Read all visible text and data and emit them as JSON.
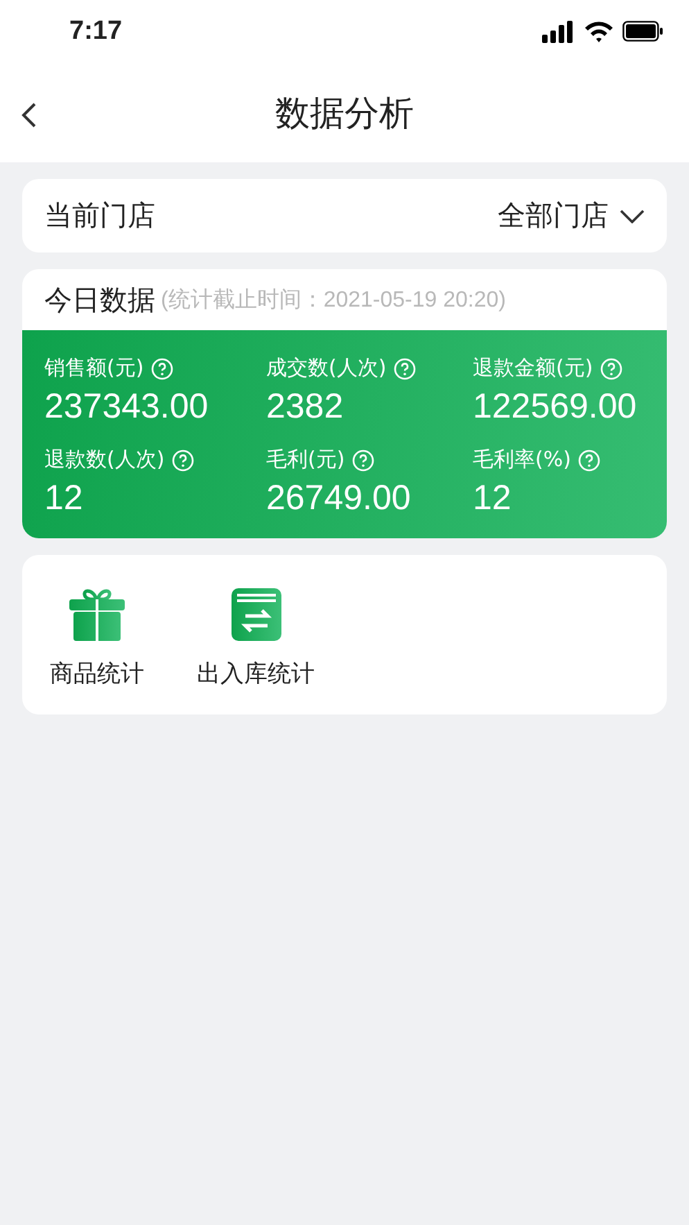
{
  "status_bar": {
    "time": "7:17"
  },
  "nav": {
    "title": "数据分析"
  },
  "store": {
    "label": "当前门店",
    "value": "全部门店"
  },
  "today": {
    "title": "今日数据",
    "note": "(统计截止时间：2021-05-19 20:20)",
    "metrics": [
      {
        "label": "销售额(元)",
        "value": "237343.00"
      },
      {
        "label": "成交数(人次)",
        "value": "2382"
      },
      {
        "label": "退款金额(元)",
        "value": "122569.00"
      },
      {
        "label": "退款数(人次)",
        "value": "12"
      },
      {
        "label": "毛利(元)",
        "value": "26749.00"
      },
      {
        "label": "毛利率(%)",
        "value": "12"
      }
    ]
  },
  "shortcuts": [
    {
      "kind": "gift",
      "label": "商品统计"
    },
    {
      "kind": "box",
      "label": "出入库统计"
    }
  ]
}
